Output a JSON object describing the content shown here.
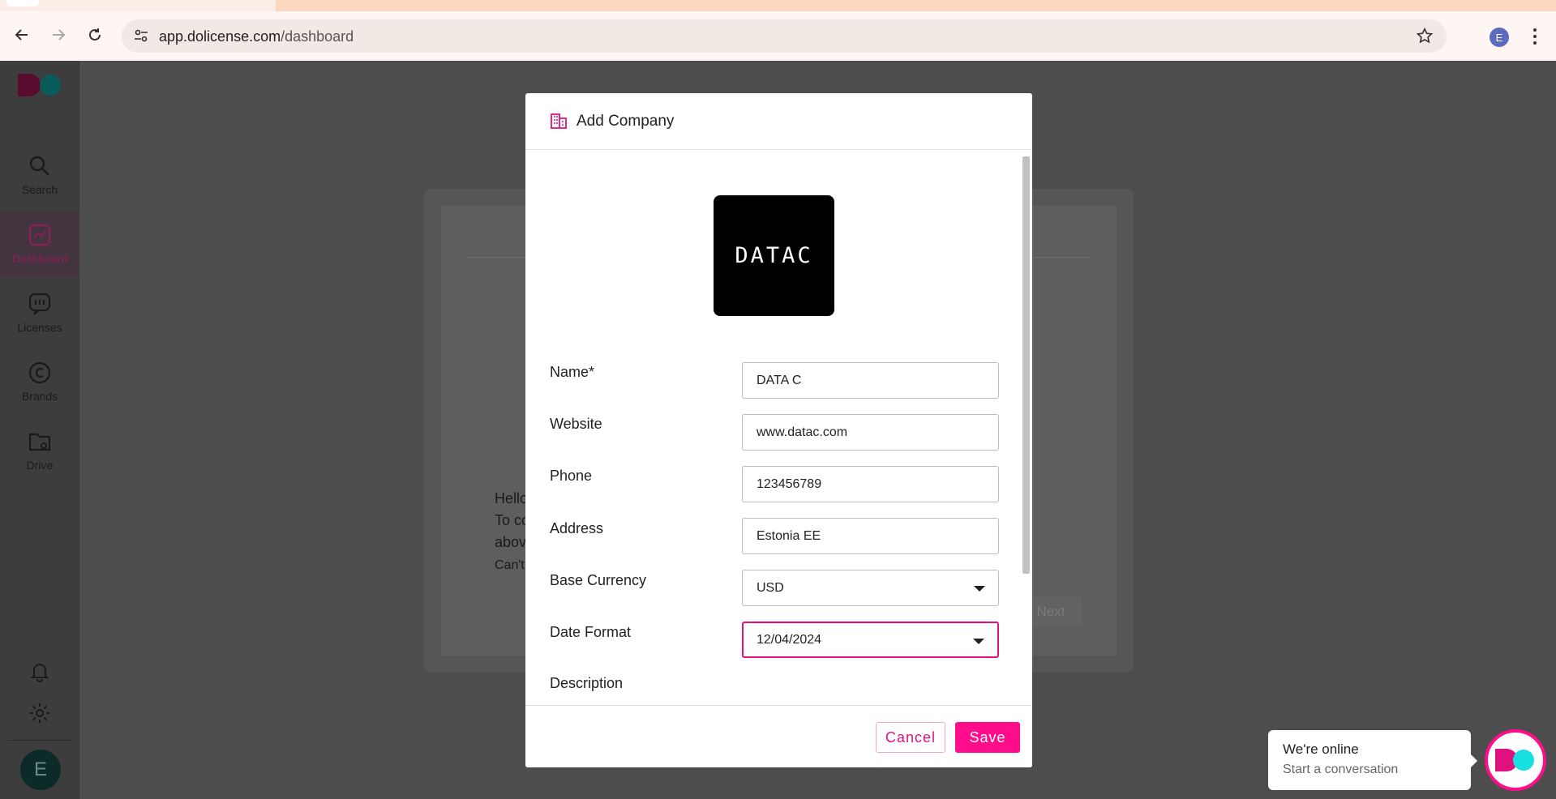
{
  "browser": {
    "url_host": "app.dolicense.com",
    "url_path": "/dashboard",
    "profile_initial": "E"
  },
  "sidebar": {
    "items": [
      {
        "label": "Search",
        "icon": "search-icon"
      },
      {
        "label": "Dashboard",
        "icon": "dashboard-icon",
        "active": true
      },
      {
        "label": "Licenses",
        "icon": "licenses-icon"
      },
      {
        "label": "Brands",
        "icon": "copyright-icon"
      },
      {
        "label": "Drive",
        "icon": "drive-folder-icon"
      }
    ],
    "avatar_initial": "E",
    "bottom_icons": [
      "bell-icon",
      "gear-icon"
    ]
  },
  "background_card": {
    "line1": "Hello",
    "line2": "To co",
    "line3": "abov",
    "line4": "Can't",
    "next_label": "Next"
  },
  "modal": {
    "title": "Add Company",
    "logo_text": "DATAC",
    "fields": {
      "name_label": "Name*",
      "name_value": "DATA C",
      "website_label": "Website",
      "website_value": "www.datac.com",
      "phone_label": "Phone",
      "phone_value": "123456789",
      "address_label": "Address",
      "address_value": "Estonia EE",
      "currency_label": "Base Currency",
      "currency_value": "USD",
      "date_label": "Date Format",
      "date_value": "12/04/2024",
      "description_label": "Description"
    },
    "cancel_label": "Cancel",
    "save_label": "Save"
  },
  "chat": {
    "title": "We're online",
    "subtitle": "Start a conversation"
  },
  "colors": {
    "accent": "#ff0d8a",
    "active_nav": "#8c1f55",
    "overlay_bg": "#4d4d4d"
  }
}
